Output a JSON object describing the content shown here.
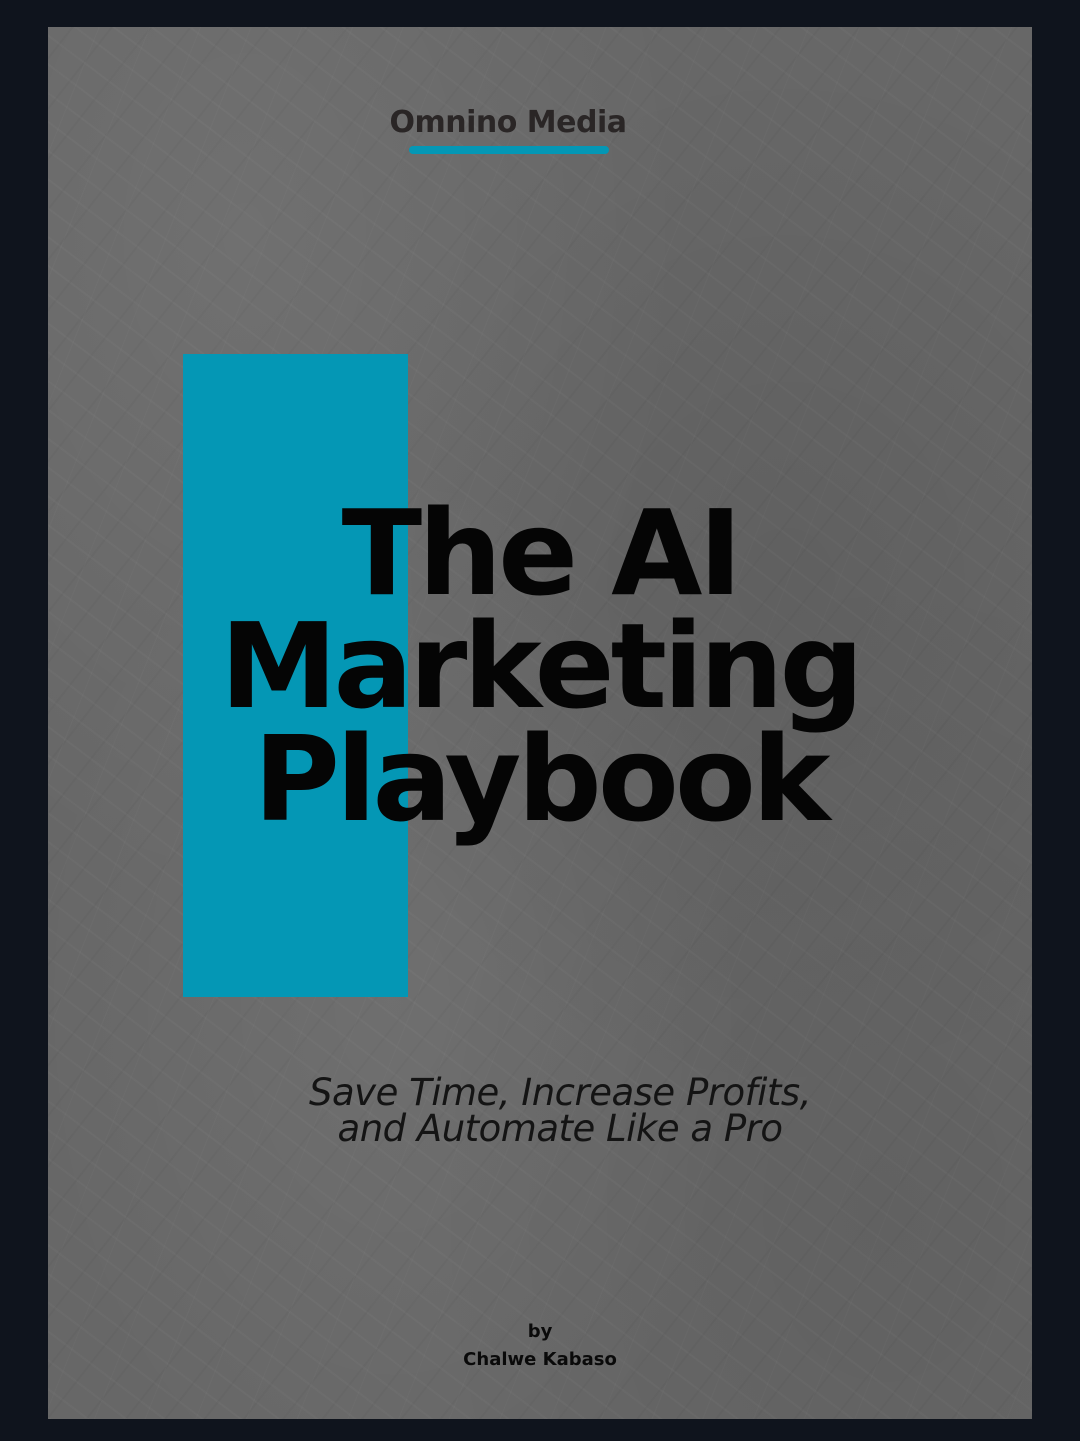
{
  "cover": {
    "publisher": "Omnino Media",
    "title_lines": [
      "The AI",
      "Marketing",
      "Playbook"
    ],
    "subtitle_lines": [
      "Save Time, Increase Profits,",
      "and Automate Like a Pro"
    ],
    "by_label": "by",
    "author": "Chalwe Kabaso"
  },
  "colors": {
    "accent": "#0497b5",
    "paper": "#676767",
    "frame": "#0f141d",
    "text": "#050505"
  }
}
